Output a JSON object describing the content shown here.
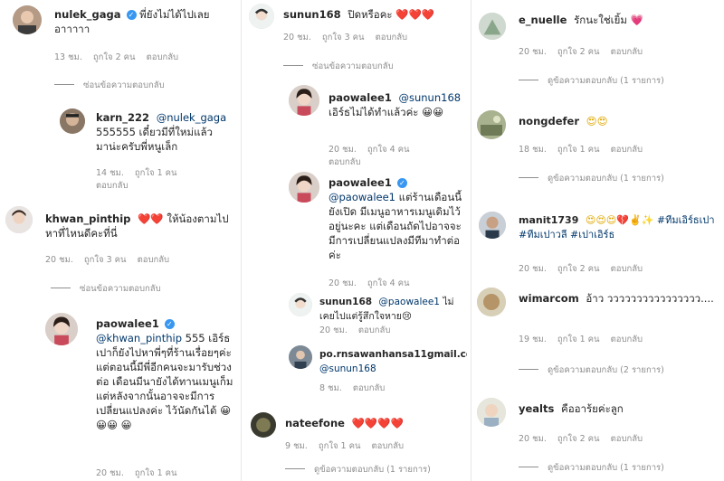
{
  "meta_labels": {
    "like_prefix": "ถูกใจ",
    "reply": "ตอบกลับ"
  },
  "col1": {
    "c1": {
      "user": "nulek_gaga",
      "text": "พี่ยังไม่ได้ไปเลย อาาาาา",
      "time": "13 ชม.",
      "likes": "ถูกใจ 2 คน",
      "reply": "ตอบกลับ"
    },
    "c1_thread": "ซ่อนข้อความตอบกลับ",
    "c1r": {
      "user": "karn_222",
      "mention": "@nulek_gaga",
      "text": "555555 เดี๋ยวมีที่ใหม่แล้ว มาน่ะครับพี่หนูเล็ก",
      "time": "14 ชม.",
      "likes": "ถูกใจ 1 คน",
      "reply": "ตอบกลับ"
    },
    "c2": {
      "user": "khwan_pinthip",
      "emoji": "❤️❤️",
      "text": "ให้น้องตามไปหาที่ไหนดีคะที่นี่",
      "time": "20 ชม.",
      "likes": "ถูกใจ 3 คน",
      "reply": "ตอบกลับ"
    },
    "c2_thread": "ซ่อนข้อความตอบกลับ",
    "c2r": {
      "user": "paowalee1",
      "mention": "@khwan_pinthip",
      "text": "555 เอิร์ธเปาก็ยังไปหาพี่ๆที่ร้านเรื่อยๆค่ะ แต่ตอนนี้มีพี่อีกคนจะมารับช่วงต่อ เดือนมีนายังได้ทานเมนูเก็ม แต่หลังจากนั้นอาจจะมีการเปลี่ยนแปลงค่ะ ไว้นัดกันได้ 😀😀😀 😀",
      "time": "20 ชม.",
      "likes": "ถูกใจ 1 คน"
    }
  },
  "col2": {
    "c1": {
      "user": "sunun168",
      "text": "ปิดหรือคะ",
      "emoji": "❤️❤️❤️",
      "time": "20 ชม.",
      "likes": "ถูกใจ 3 คน",
      "reply": "ตอบกลับ"
    },
    "c1_thread": "ซ่อนข้อความตอบกลับ",
    "r1": {
      "user": "paowalee1",
      "mention": "@sunun168",
      "text": "เอิร์ธไม่ได้ทำแล้วค่ะ 😀😀",
      "time": "20 ชม.",
      "likes": "ถูกใจ 4 คน",
      "reply": "ตอบกลับ"
    },
    "r2": {
      "user": "paowalee1",
      "mention": "@paowalee1",
      "text": "แต่ร้านเดือนนี้ยังเปิด มีเมนูอาหารเมนูเดิมไว้อยู่นะคะ แต่เดือนถัดไปอาจจะมีการเปลี่ยนแปลงมีทีมาทำต่อค่ะ",
      "time": "20 ชม.",
      "likes": "ถูกใจ 4 คน"
    },
    "r3": {
      "user": "sunun168",
      "mention": "@paowalee1",
      "text": "ไม่เคยไปแต่รู้สึกใจหาย😢",
      "time": "20 ชม.",
      "reply": "ตอบกลับ"
    },
    "r4": {
      "user": "po.rnsawanhansa11gmail.com6",
      "mention": "@sunun168",
      "time": "8 ชม.",
      "reply": "ตอบกลับ"
    },
    "c2": {
      "user": "nateefone",
      "emoji": "❤️❤️❤️❤️",
      "time": "9 ชม.",
      "likes": "ถูกใจ 1 คน",
      "reply": "ตอบกลับ"
    },
    "c2_thread": "ดูข้อความตอบกลับ (1 รายการ)"
  },
  "col3": {
    "c1": {
      "user": "e_nuelle",
      "text": "รักนะใช่เยิ้ม 💗",
      "time": "20 ชม.",
      "likes": "ถูกใจ 2 คน",
      "reply": "ตอบกลับ"
    },
    "c1_thread": "ดูข้อความตอบกลับ (1 รายการ)",
    "c2": {
      "user": "nongdefer",
      "emoji": "😍😍",
      "time": "18 ชม.",
      "likes": "ถูกใจ 1 คน",
      "reply": "ตอบกลับ"
    },
    "c2_thread": "ดูข้อความตอบกลับ (1 รายการ)",
    "c3": {
      "user": "manit1739",
      "emoji": "😍😍😍💔✌️✨",
      "hashtags": "#ทีมเอิร์ธเปา #ทีมเปาวลี #เปาเอิร์ธ",
      "time": "20 ชม.",
      "likes": "ถูกใจ 2 คน",
      "reply": "ตอบกลับ"
    },
    "c4": {
      "user": "wimarcom",
      "text": "อ้าว วววววววววววววววว....",
      "time": "19 ชม.",
      "likes": "ถูกใจ 1 คน",
      "reply": "ตอบกลับ"
    },
    "c4_thread": "ดูข้อความตอบกลับ (2 รายการ)",
    "c5": {
      "user": "yealts",
      "text": "คืออาร้ยค่ะลูก",
      "time": "20 ชม.",
      "likes": "ถูกใจ 2 คน",
      "reply": "ตอบกลับ"
    },
    "c5_thread": "ดูข้อความตอบกลับ (1 รายการ)"
  }
}
